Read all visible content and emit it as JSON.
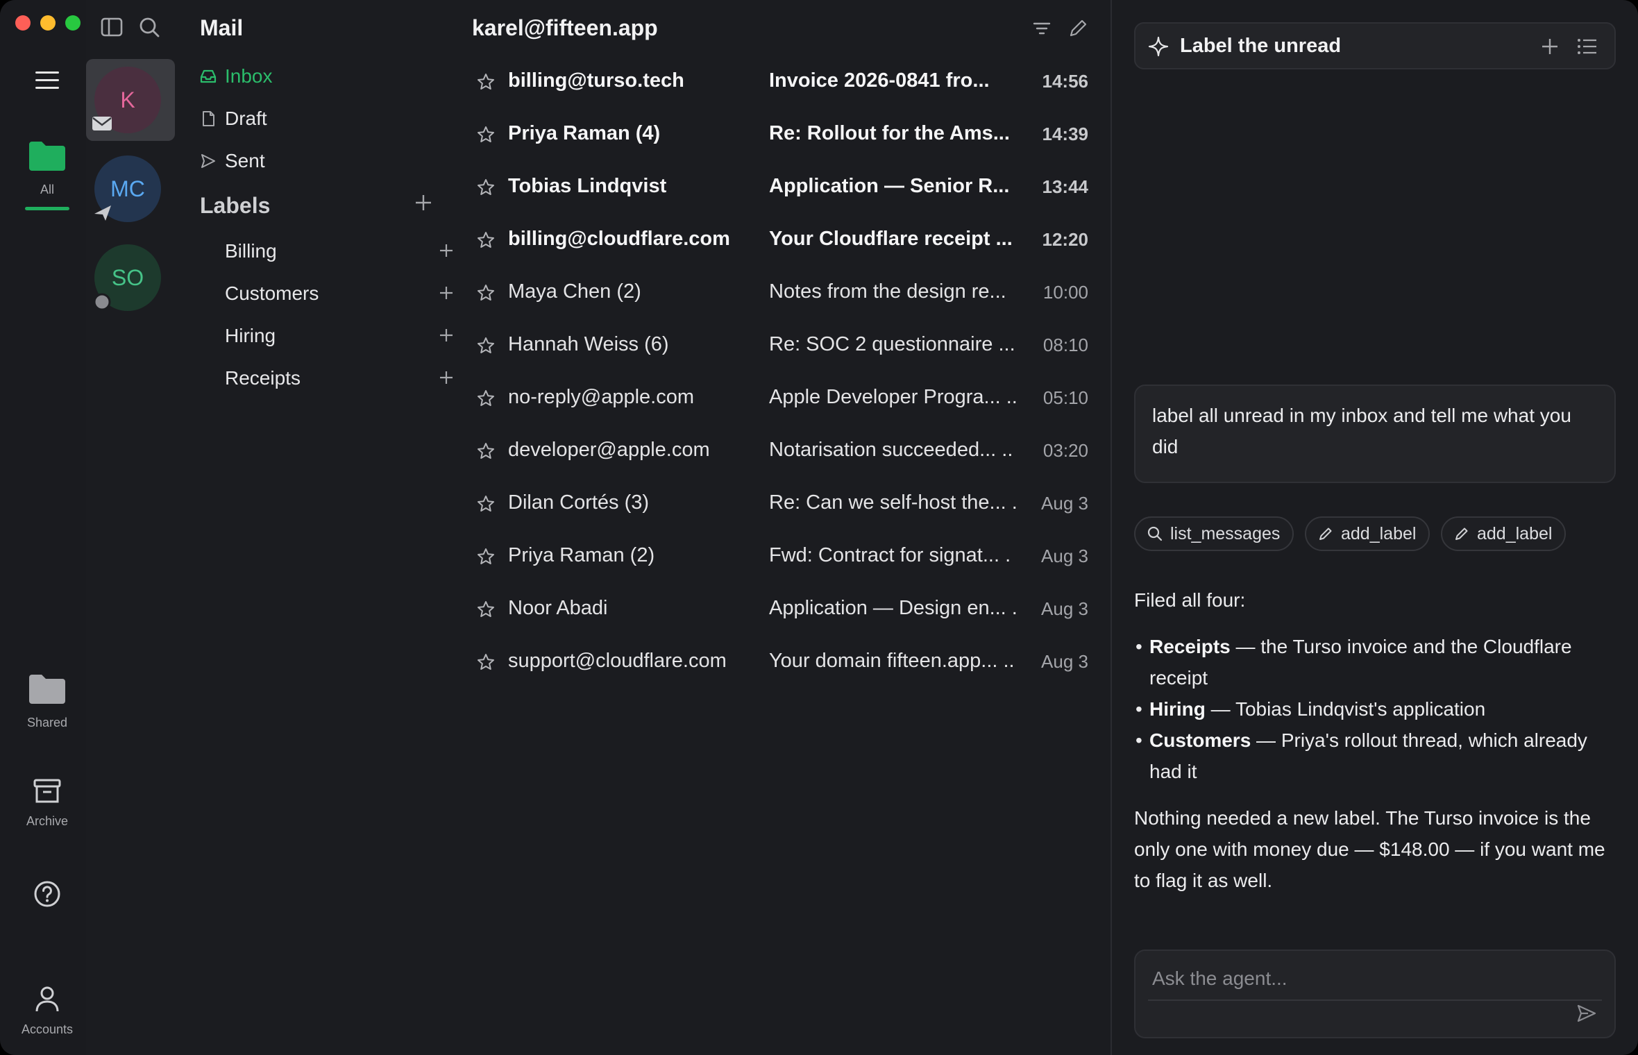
{
  "rail": {
    "items": [
      {
        "label": "All",
        "icon": "folder-icon"
      },
      {
        "label": "Shared",
        "icon": "folder-icon"
      },
      {
        "label": "Archive",
        "icon": "archive-icon"
      },
      {
        "label": "",
        "icon": "help-icon"
      },
      {
        "label": "Accounts",
        "icon": "person-icon"
      }
    ]
  },
  "accounts": [
    {
      "initials": "K",
      "color": "#e4679b"
    },
    {
      "initials": "MC",
      "color": "#5aa9f2"
    },
    {
      "initials": "SO",
      "color": "#46c388"
    }
  ],
  "sidebar": {
    "title": "Mail",
    "folders": [
      "Inbox",
      "Draft",
      "Sent"
    ],
    "labels_heading": "Labels",
    "labels": [
      "Billing",
      "Customers",
      "Hiring",
      "Receipts"
    ]
  },
  "list": {
    "account": "karel@fifteen.app",
    "messages": [
      {
        "sender": "billing@turso.tech",
        "subject": "Invoice 2026-0841 fro...",
        "time": "14:56",
        "unread": true
      },
      {
        "sender": "Priya Raman (4)",
        "subject": "Re: Rollout for the Ams...",
        "time": "14:39",
        "unread": true
      },
      {
        "sender": "Tobias Lindqvist",
        "subject": "Application — Senior R...",
        "time": "13:44",
        "unread": true
      },
      {
        "sender": "billing@cloudflare.com",
        "subject": "Your Cloudflare receipt ...",
        "time": "12:20",
        "unread": true
      },
      {
        "sender": "Maya Chen (2)",
        "subject": "Notes from the design re...",
        "time": "10:00",
        "unread": false
      },
      {
        "sender": "Hannah Weiss (6)",
        "subject": "Re: SOC 2 questionnaire ...",
        "time": "08:10",
        "unread": false
      },
      {
        "sender": "no-reply@apple.com",
        "subject": "Apple Developer Progra... ..",
        "time": "05:10",
        "unread": false
      },
      {
        "sender": "developer@apple.com",
        "subject": "Notarisation succeeded... ..",
        "time": "03:20",
        "unread": false
      },
      {
        "sender": "Dilan Cortés (3)",
        "subject": "Re: Can we self-host the... .",
        "time": "Aug 3",
        "unread": false
      },
      {
        "sender": "Priya Raman (2)",
        "subject": "Fwd: Contract for signat... .",
        "time": "Aug 3",
        "unread": false
      },
      {
        "sender": "Noor Abadi",
        "subject": "Application — Design en... .",
        "time": "Aug 3",
        "unread": false
      },
      {
        "sender": "support@cloudflare.com",
        "subject": "Your domain fifteen.app... ..",
        "time": "Aug 3",
        "unread": false
      }
    ]
  },
  "agent": {
    "title": "Label the unread",
    "user_message": "label all unread in my inbox and tell me what you did",
    "tool_calls": [
      "list_messages",
      "add_label",
      "add_label"
    ],
    "reply": {
      "intro": "Filed all four:",
      "items": [
        {
          "label": "Receipts",
          "text": " — the Turso invoice and the Cloudflare receipt"
        },
        {
          "label": "Hiring",
          "text": " — Tobias Lindqvist's application"
        },
        {
          "label": "Customers",
          "text": " — Priya's rollout thread, which already had it"
        }
      ],
      "outro": "Nothing needed a new label. The Turso invoice is the only one with money due — $148.00 — if you want me to flag it as well."
    },
    "composer_placeholder": "Ask the agent..."
  },
  "colors": {
    "accent": "#1fae5d",
    "background": "#1b1c20"
  }
}
